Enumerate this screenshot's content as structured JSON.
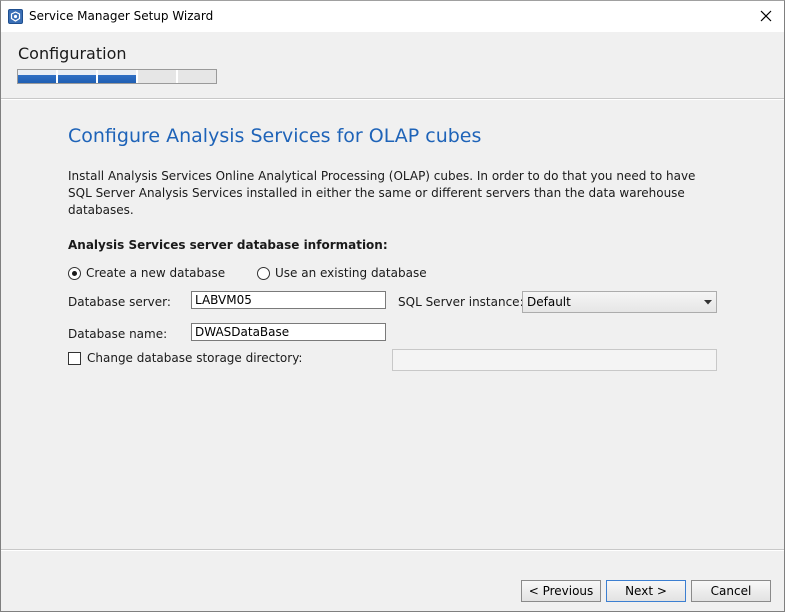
{
  "window": {
    "title": "Service Manager Setup Wizard",
    "icon": "service-manager-app-icon",
    "close_icon": "close-icon"
  },
  "header": {
    "title": "Configuration",
    "progress": {
      "steps_total": 5,
      "steps_completed": 3,
      "accent_color": "#2e6fc4"
    }
  },
  "page": {
    "heading": "Configure Analysis Services for OLAP cubes",
    "heading_color": "#1e63b8",
    "description": "Install Analysis Services Online Analytical Processing (OLAP) cubes. In order to do that you need to have SQL Server Analysis Services installed in either the same or different servers than the data warehouse databases.",
    "section_label": "Analysis Services server database information:",
    "options": {
      "create_new": {
        "label": "Create a new database",
        "checked": true
      },
      "use_existing": {
        "label": "Use an existing database",
        "checked": false
      }
    },
    "fields": {
      "database_server": {
        "label": "Database server:",
        "value": "LABVM05"
      },
      "sql_server_instance": {
        "label": "SQL Server instance:",
        "value": "Default"
      },
      "database_name": {
        "label": "Database name:",
        "value": "DWASDataBase"
      },
      "storage_directory": {
        "label": "Change database storage directory:",
        "checked": false,
        "value": ""
      }
    }
  },
  "footer": {
    "previous_label": "< Previous",
    "next_label": "Next >",
    "cancel_label": "Cancel"
  }
}
